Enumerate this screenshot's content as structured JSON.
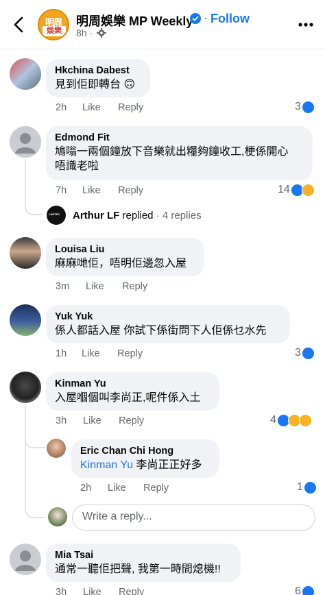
{
  "header": {
    "page_name": "明周娛樂 MP Weekly",
    "follow_label": "Follow",
    "dot": "·",
    "post_time": "8h ·",
    "avatar_text_top": "明周",
    "avatar_text_bottom": "娛樂"
  },
  "comments": [
    {
      "author": "Hkchina Dabest",
      "text": "見到佢即轉台 🙃",
      "time": "2h",
      "like": "Like",
      "reply": "Reply",
      "reactions": "3"
    },
    {
      "author": "Edmond Fit",
      "text_line1": "鳩嗡一兩個鐘放下音樂就出糧夠鐘收工,梗係開心",
      "text_line2": "唔識老啦",
      "time": "7h",
      "like": "Like",
      "reply": "Reply",
      "reactions": "14",
      "replied": {
        "name": "Arthur LF",
        "verb": "replied",
        "count": "· 4 replies",
        "avatar_text": "LIMITED"
      }
    },
    {
      "author": "Louisa Liu",
      "text": "麻麻哋佢，唔明佢邊忽入屋",
      "time": "3m",
      "like": "Like",
      "reply": "Reply"
    },
    {
      "author": "Yuk Yuk",
      "text": "係人都話入屋 你試下係街問下人佢係乜水先",
      "time": "1h",
      "like": "Like",
      "reply": "Reply",
      "reactions": "3"
    },
    {
      "author": "Kinman Yu",
      "text": "入屋嗰個叫李尚正,呢件係入土",
      "time": "3h",
      "like": "Like",
      "reply": "Reply",
      "reactions": "4",
      "sub_reply": {
        "author": "Eric Chan Chi Hong",
        "mention": "Kinman Yu",
        "text": " 李尚正正好多",
        "time": "2h",
        "like": "Like",
        "reply": "Reply",
        "reactions": "1"
      }
    },
    {
      "author": "Mia Tsai",
      "text": "通常一聽佢把聲, 我第一時間熄機!!",
      "time": "3h",
      "like": "Like",
      "reply": "Reply",
      "reactions": "6"
    }
  ],
  "write_reply": {
    "placeholder": "Write a reply..."
  },
  "colors": {
    "accent": "#1877f2",
    "bubble": "#f0f2f5",
    "muted": "#65676b"
  }
}
